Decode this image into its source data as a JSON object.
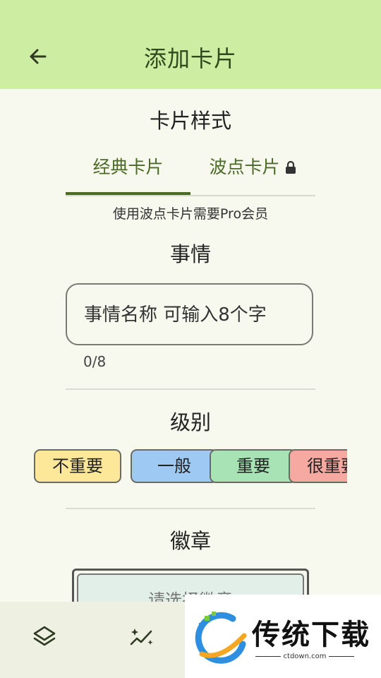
{
  "app_bar": {
    "title": "添加卡片"
  },
  "card_style": {
    "heading": "卡片样式",
    "tabs": [
      {
        "label": "经典卡片"
      },
      {
        "label": "波点卡片"
      }
    ],
    "hint": "使用波点卡片需要Pro会员"
  },
  "event": {
    "heading": "事情",
    "placeholder": "事情名称 可输入8个字",
    "counter": "0/8"
  },
  "level": {
    "heading": "级别",
    "options": [
      {
        "label": "不重要",
        "color": "#fde89a"
      },
      {
        "label": "一般",
        "color": "#9ec9f2"
      },
      {
        "label": "重要",
        "color": "#a8e3b5"
      },
      {
        "label": "很重要",
        "color": "#f6a9a1"
      }
    ]
  },
  "badge": {
    "heading": "徽章",
    "placeholder": "请选择徽章"
  },
  "bottom_nav": {
    "items": [
      {
        "icon": "layers-icon"
      },
      {
        "icon": "sparkle-chart-icon"
      }
    ]
  },
  "ad_overlay": {
    "brand": "传统下载",
    "url": "ctdown.com"
  },
  "colors": {
    "appbar": "#cdeda3",
    "accent": "#4a6a25",
    "background": "#f7f8ee"
  }
}
